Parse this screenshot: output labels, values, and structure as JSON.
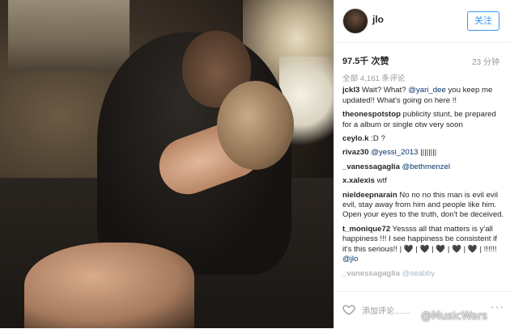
{
  "post": {
    "username": "jlo",
    "follow_label": "关注",
    "likes": "97.5千 次赞",
    "time": "23 分钟",
    "comments_total": "全部 4,161 条评论",
    "add_comment_placeholder": "添加评论……",
    "more_label": "···"
  },
  "comments": [
    {
      "user": "jckl3",
      "parts": [
        {
          "t": " Wait? What? "
        },
        {
          "t": "@yari_dee",
          "m": true
        },
        {
          "t": " you keep me updated!! What's going on here !!"
        }
      ]
    },
    {
      "user": "theonespotstop",
      "parts": [
        {
          "t": " publicity stunt, be prepared for a album or single otw very soon"
        }
      ]
    },
    {
      "user": "ceylo.k",
      "parts": [
        {
          "t": " :D ?"
        }
      ]
    },
    {
      "user": "rivaz30",
      "parts": [
        {
          "t": " "
        },
        {
          "t": "@yessi_2013",
          "m": true
        },
        {
          "t": " ||||||||"
        }
      ]
    },
    {
      "user": "_vanessagaglia",
      "parts": [
        {
          "t": " "
        },
        {
          "t": "@bethmenzel",
          "m": true
        }
      ]
    },
    {
      "user": "x.xalexis",
      "parts": [
        {
          "t": " wtf"
        }
      ]
    },
    {
      "user": "nieldeepnarain",
      "parts": [
        {
          "t": " No no no this man is evil evil evil, stay away from him and people like him. Open your eyes to the truth, don't be deceived."
        }
      ]
    },
    {
      "user": "t_monique72",
      "parts": [
        {
          "t": " Yessss all that matters is y'all happiness !!! I see happiness be consistent if it's this serious!! | 🖤 | 🖤 | 🖤 | 🖤 | 🖤 | !!!!!! "
        },
        {
          "t": "@jlo",
          "m": true
        }
      ]
    },
    {
      "user": "_vanessagaglia",
      "faded": true,
      "parts": [
        {
          "t": " "
        },
        {
          "t": "@seabby",
          "m": true
        }
      ]
    }
  ],
  "watermark": "@MusicWars"
}
